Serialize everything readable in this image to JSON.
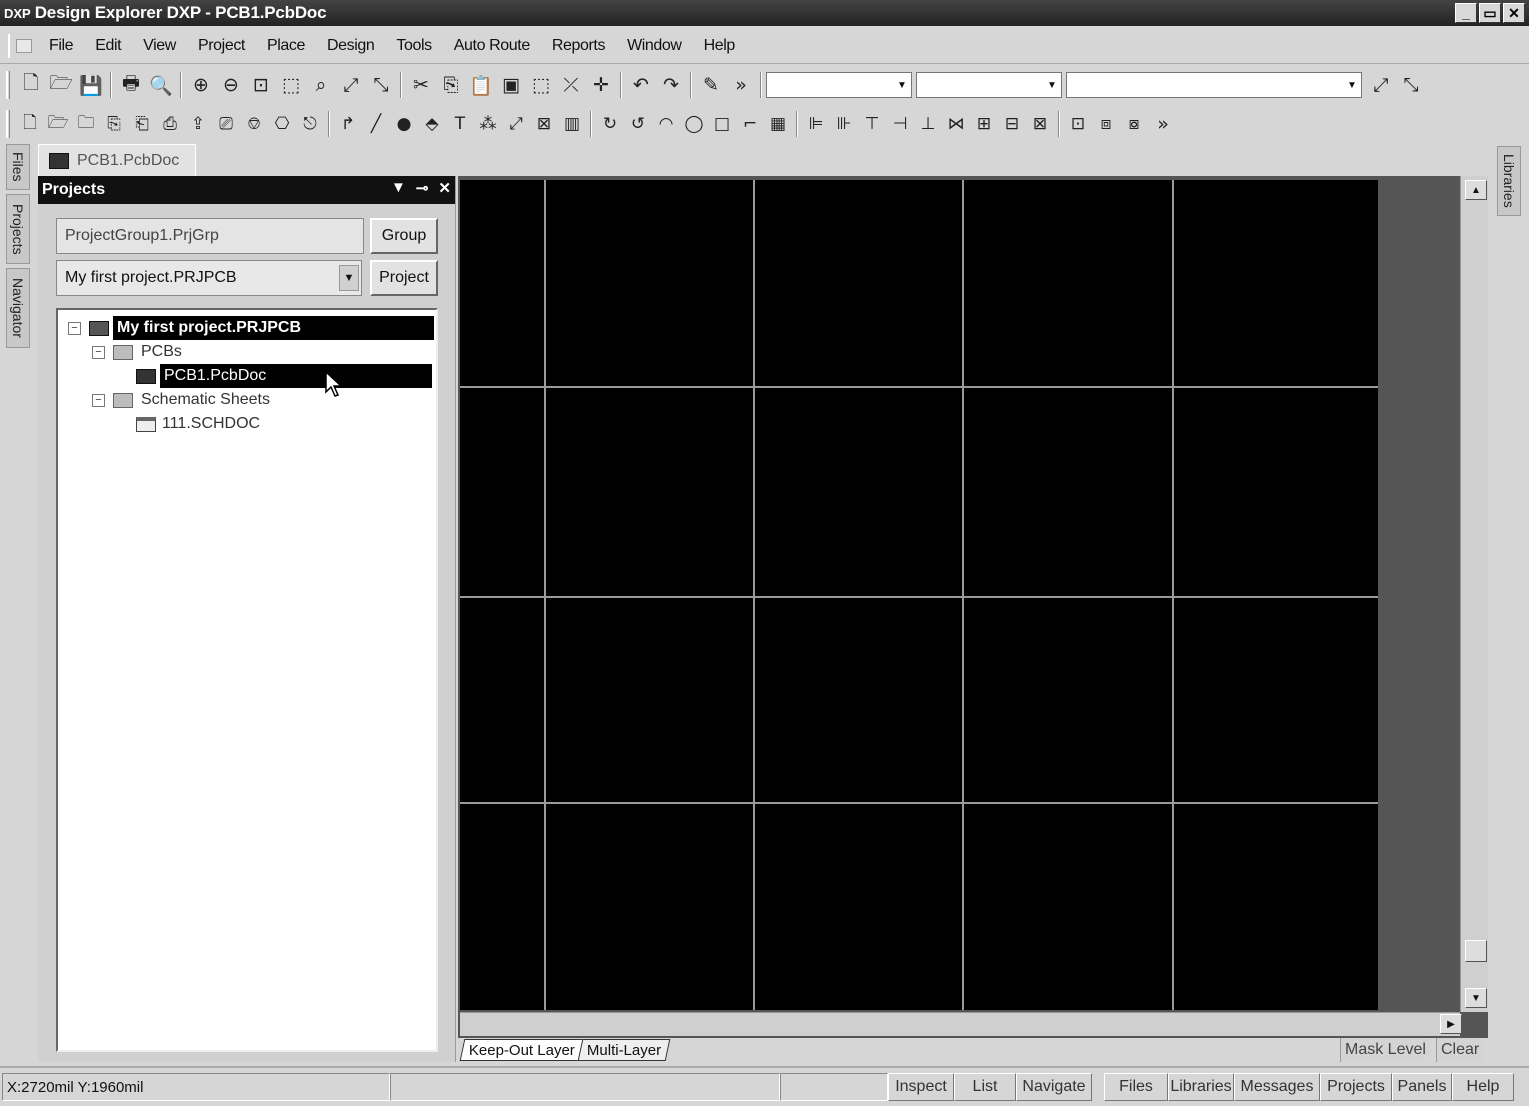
{
  "window": {
    "app_icon": "DXP",
    "title": "Design Explorer DXP - PCB1.PcbDoc",
    "minimize": "_",
    "restore": "▭",
    "close": "✕"
  },
  "menu": [
    {
      "label": "File",
      "name": "file"
    },
    {
      "label": "Edit",
      "name": "edit"
    },
    {
      "label": "View",
      "name": "view"
    },
    {
      "label": "Project",
      "name": "project"
    },
    {
      "label": "Place",
      "name": "place"
    },
    {
      "label": "Design",
      "name": "design"
    },
    {
      "label": "Tools",
      "name": "tools"
    },
    {
      "label": "Auto Route",
      "name": "auto-route"
    },
    {
      "label": "Reports",
      "name": "reports"
    },
    {
      "label": "Window",
      "name": "window"
    },
    {
      "label": "Help",
      "name": "help"
    }
  ],
  "toolbar1_icons": [
    "new-doc-icon",
    "open-folder-icon",
    "save-icon",
    "print-icon",
    "print-preview-icon",
    "zoom-in-icon",
    "zoom-out-icon",
    "zoom-fit-icon",
    "zoom-area-icon",
    "zoom-selected-icon",
    "cross-probe-icon",
    "cross-select-icon",
    "cut-icon",
    "copy-icon",
    "paste-icon",
    "rubber-stamp-icon",
    "select-area-icon",
    "deselect-icon",
    "move-icon",
    "undo-icon",
    "redo-icon",
    "pencil-icon"
  ],
  "toolbar1_glyphs": [
    "🗋",
    "🗁",
    "💾",
    "🖶",
    "🔍",
    "⊕",
    "⊖",
    "⊡",
    "⬚",
    "⌕",
    "⤢",
    "⤡",
    "✂",
    "⎘",
    "📋",
    "▣",
    "⬚",
    "⤫",
    "✛",
    "↶",
    "↷",
    "✎"
  ],
  "toolbar1_more": "»",
  "toolbar2_icons": [
    "doc-a-icon",
    "doc-b-icon",
    "doc-c-icon",
    "doc-d-icon",
    "doc-e-icon",
    "doc-f-icon",
    "doc-g-icon",
    "doc-h-icon",
    "doc-i-icon",
    "doc-j-icon",
    "doc-k-icon",
    "interactive-route-icon",
    "line-icon",
    "via-icon",
    "pad-icon",
    "text-icon",
    "coordinate-icon",
    "dimension-icon",
    "component-icon",
    "fill-icon",
    "arc-center-icon",
    "arc-edge-icon",
    "arc-any-icon",
    "circle-icon",
    "rectangle-icon",
    "polygon-icon",
    "array-icon",
    "align-left-icon",
    "align-right-icon",
    "align-top-icon",
    "space-horizontal-icon",
    "space-vertical-icon",
    "distribute-icon",
    "align-bottom-icon",
    "align-center-icon",
    "spread-icon",
    "increase-spacing-icon",
    "room-a-icon",
    "room-b-icon"
  ],
  "toolbar2_glyphs": [
    "🗋",
    "🗁",
    "🗀",
    "⎘",
    "⎗",
    "⎙",
    "⇪",
    "⎚",
    "⎊",
    "⎔",
    "⎋",
    "↱",
    "╱",
    "●",
    "⬘",
    "T",
    "⁂",
    "⤢",
    "⊠",
    "▥",
    "↻",
    "↺",
    "◠",
    "◯",
    "□",
    "⌐",
    "▦",
    "⊫",
    "⊪",
    "⊤",
    "⊣",
    "⊥",
    "⋈",
    "⊞",
    "⊟",
    "⊠",
    "⊡",
    "⧈",
    "⧇"
  ],
  "toolbar2_more": "»",
  "side_tabs_left": [
    "Files",
    "Projects",
    "Navigator"
  ],
  "side_tabs_right": [
    "Libraries"
  ],
  "document_tab": "PCB1.PcbDoc",
  "projects_panel": {
    "title": "Projects",
    "dropdown_icon": "▼",
    "pin_icon": "⊸",
    "close_icon": "✕",
    "group_field": "ProjectGroup1.PrjGrp",
    "project_combo": "My first project.PRJPCB",
    "group_button": "Group",
    "project_button": "Project",
    "tree": {
      "project": "My first project.PRJPCB",
      "pcbs_folder": "PCBs",
      "pcb_doc": "PCB1.PcbDoc",
      "schematic_folder": "Schematic Sheets",
      "sch_doc": "111.SCHDOC",
      "collapse_glyph": "−"
    }
  },
  "canvas": {
    "background": "#000000",
    "grid_color": "#9a9a9a"
  },
  "layers": {
    "tabs": [
      "Keep-Out Layer",
      "Multi-Layer"
    ],
    "mask_level": "Mask Level",
    "clear": "Clear"
  },
  "status": {
    "coords": "X:2720mil Y:1960mil",
    "buttons": [
      "Inspect",
      "List",
      "Navigate"
    ],
    "panel_buttons": [
      "Files",
      "Libraries",
      "Messages",
      "Projects",
      "Panels",
      "Help"
    ]
  },
  "scroll": {
    "up": "▲",
    "down": "▼",
    "right": "▶"
  }
}
